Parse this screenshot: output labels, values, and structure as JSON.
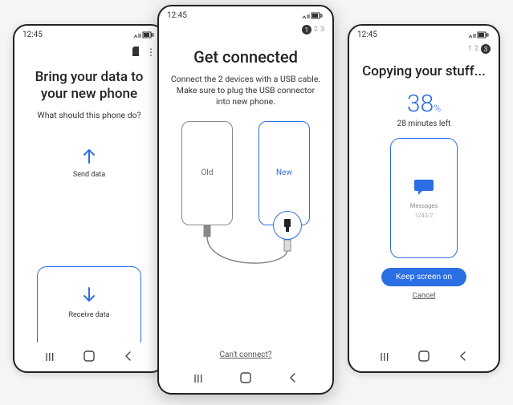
{
  "status": {
    "time": "12:45"
  },
  "left": {
    "title": "Bring your data to your new phone",
    "subtitle": "What should this phone do?",
    "send_label": "Send data",
    "receive_label": "Receive data"
  },
  "center": {
    "steps": [
      "1",
      "2",
      "3"
    ],
    "active_step": 0,
    "title": "Get connected",
    "subtitle": "Connect the 2 devices with a USB cable. Make sure to plug the USB connector into new phone.",
    "old_label": "Old",
    "new_label": "New",
    "cant_connect": "Can't connect?"
  },
  "right": {
    "steps": [
      "1",
      "2",
      "3"
    ],
    "active_step": 2,
    "title": "Copying your stuff...",
    "percent": "38",
    "percent_symbol": "%",
    "time_left": "28 minutes left",
    "item_label": "Messages",
    "item_count": "1243/2",
    "keep_screen": "Keep screen on",
    "cancel": "Cancel"
  },
  "colors": {
    "accent": "#2b6fe4"
  }
}
